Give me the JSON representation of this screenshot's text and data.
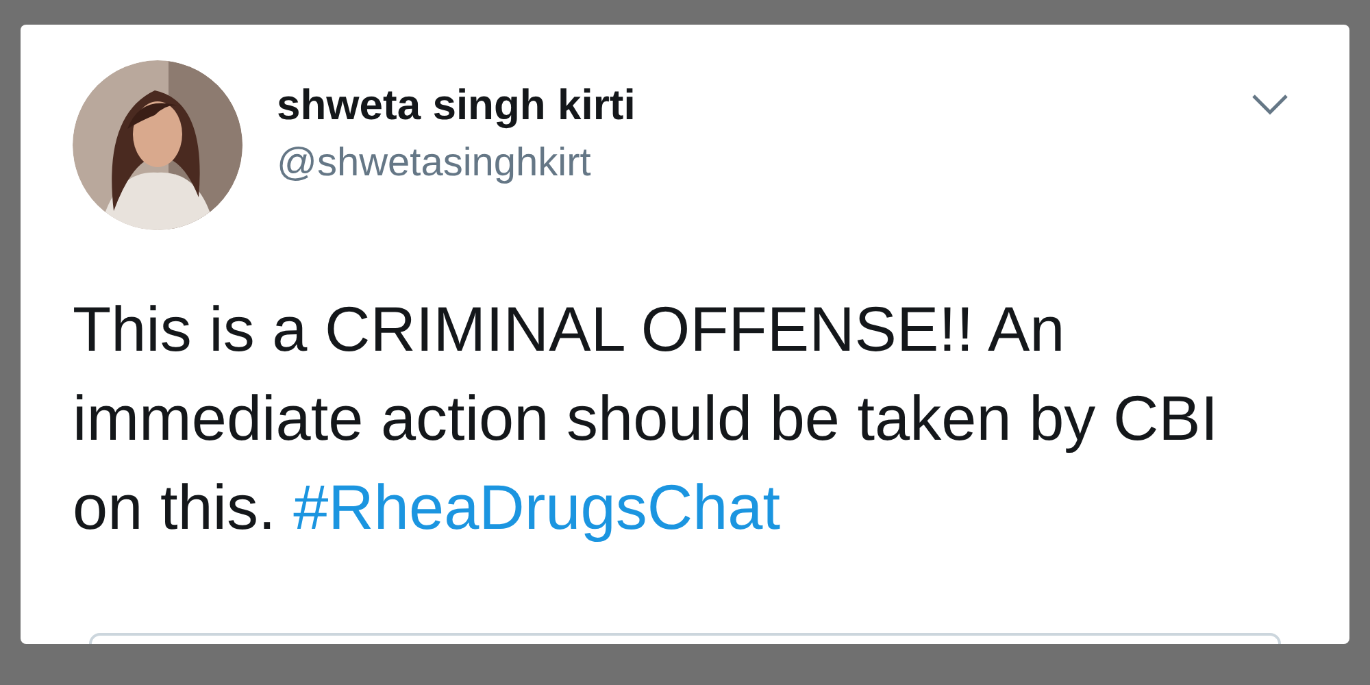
{
  "tweet": {
    "author": {
      "name": "shweta singh kirti",
      "handle": "@shwetasinghkirt"
    },
    "text": "This is a CRIMINAL OFFENSE!! An immediate action should be taken by CBI on this.",
    "hashtag": "#RheaDrugsChat"
  }
}
